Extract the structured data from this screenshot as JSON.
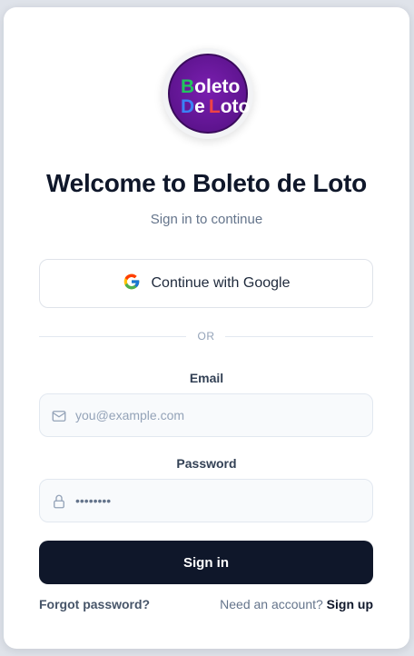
{
  "logo": {
    "line1": "Boleto",
    "line2": "De Loto",
    "background": "#6a1aa0"
  },
  "header": {
    "title": "Welcome to Boleto de Loto",
    "subtitle": "Sign in to continue"
  },
  "google": {
    "label": "Continue with Google",
    "icon": "google-icon"
  },
  "divider": {
    "text": "OR"
  },
  "email": {
    "label": "Email",
    "placeholder": "you@example.com",
    "value": "",
    "icon": "mail-icon"
  },
  "password": {
    "label": "Password",
    "value": "password",
    "icon": "lock-icon"
  },
  "actions": {
    "signin_label": "Sign in",
    "forgot_label": "Forgot password?",
    "signup_prompt": "Need an account?",
    "signup_label": "Sign up"
  },
  "colors": {
    "primary": "#0f172a",
    "muted": "#64748b",
    "border": "#e2e8f0"
  }
}
